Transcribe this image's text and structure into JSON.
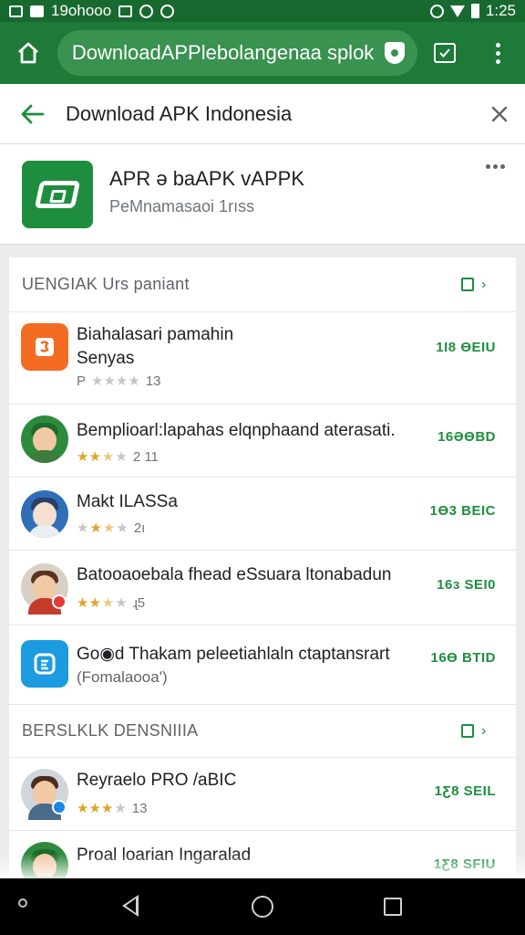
{
  "status_bar": {
    "carrier_text": "19ohooo",
    "time": "1:25"
  },
  "browser": {
    "url": "DownloadAPPlebolangenaa splok"
  },
  "sub_header": {
    "title": "Download APK Indonesia"
  },
  "featured_app": {
    "title": "APR ə baAPK vAPPK",
    "subtitle": "PeMnamasaoi 1rıss"
  },
  "sections": [
    {
      "label": "UENGIAK Urs paniant",
      "items": [
        {
          "name": "Biahalasari pamahin",
          "name2": "Senyas",
          "rating_text": "P",
          "stars": 0,
          "count": "13",
          "size": "1Ӏ8 ӨEIU"
        },
        {
          "name": "Bemplioarl:lapahas elqnphaand aterasati.",
          "rating_text": "",
          "stars": 2.5,
          "count": "2 11",
          "size": "16ӘӨBD"
        },
        {
          "name": "Makt ILASSa",
          "rating_text": "",
          "stars": 2.5,
          "count": "2ı",
          "size": "1Ө3 BEIC"
        },
        {
          "name": "Batooaoebala fhead eSsuara ltonabadun",
          "rating_text": "",
          "stars": 2.5,
          "count": "ɻ5",
          "size": "16ɜ SEI0"
        },
        {
          "name": "Go◉d Thakam peleetiahlaln ctaptansrart",
          "name2": "(Fomalaooa')",
          "rating_text": "",
          "stars": 0,
          "count": "",
          "size": "16Ө BTID"
        }
      ]
    },
    {
      "label": "BERSLKLK DENSNIIIA",
      "items": [
        {
          "name": "Reyraelo PRO /aBIC",
          "rating_text": "",
          "stars": 3,
          "count": "13",
          "size": "1Ƹ8 SEIL"
        },
        {
          "name": "Proal loarian Ingaralad",
          "rating_text": "",
          "stars": 0,
          "count": "",
          "size": "1Ƹ8 SFIU"
        }
      ]
    }
  ],
  "colors": {
    "primary": "#1e7a38",
    "accent": "#1e8e3e",
    "star": "#e2a32a"
  }
}
